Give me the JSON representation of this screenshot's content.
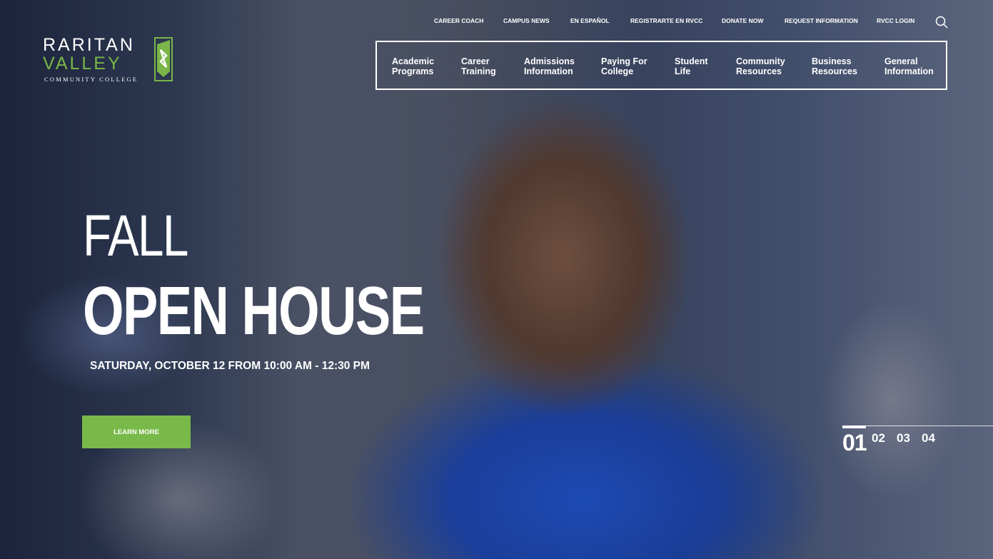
{
  "logo": {
    "line1": "RARITAN",
    "line2": "VALLEY",
    "line3": "COMMUNITY COLLEGE",
    "accent_color": "#7ab648"
  },
  "utility_nav": [
    {
      "label": "CAREER COACH"
    },
    {
      "label": "CAMPUS NEWS"
    },
    {
      "label": "EN ESPAÑOL"
    },
    {
      "label": "REGISTRARTE EN RVCC"
    },
    {
      "label": "DONATE NOW"
    },
    {
      "label": "REQUEST INFORMATION"
    },
    {
      "label": "RVCC LOGIN"
    }
  ],
  "search": {
    "icon": "search-icon"
  },
  "main_nav": [
    {
      "line1": "Academic",
      "line2": "Programs"
    },
    {
      "line1": "Career",
      "line2": "Training"
    },
    {
      "line1": "Admissions",
      "line2": "Information"
    },
    {
      "line1": "Paying For",
      "line2": "College"
    },
    {
      "line1": "Student",
      "line2": "Life"
    },
    {
      "line1": "Community",
      "line2": "Resources"
    },
    {
      "line1": "Business",
      "line2": "Resources"
    },
    {
      "line1": "General",
      "line2": "Information"
    }
  ],
  "hero": {
    "kicker": "FALL",
    "headline": "OPEN HOUSE",
    "date": "SATURDAY, OCTOBER 12 FROM 10:00 AM - 12:30 PM",
    "cta": "LEARN MORE",
    "cta_color": "#79b94a"
  },
  "slider": {
    "active": "01",
    "others": [
      "02",
      "03",
      "04"
    ]
  }
}
